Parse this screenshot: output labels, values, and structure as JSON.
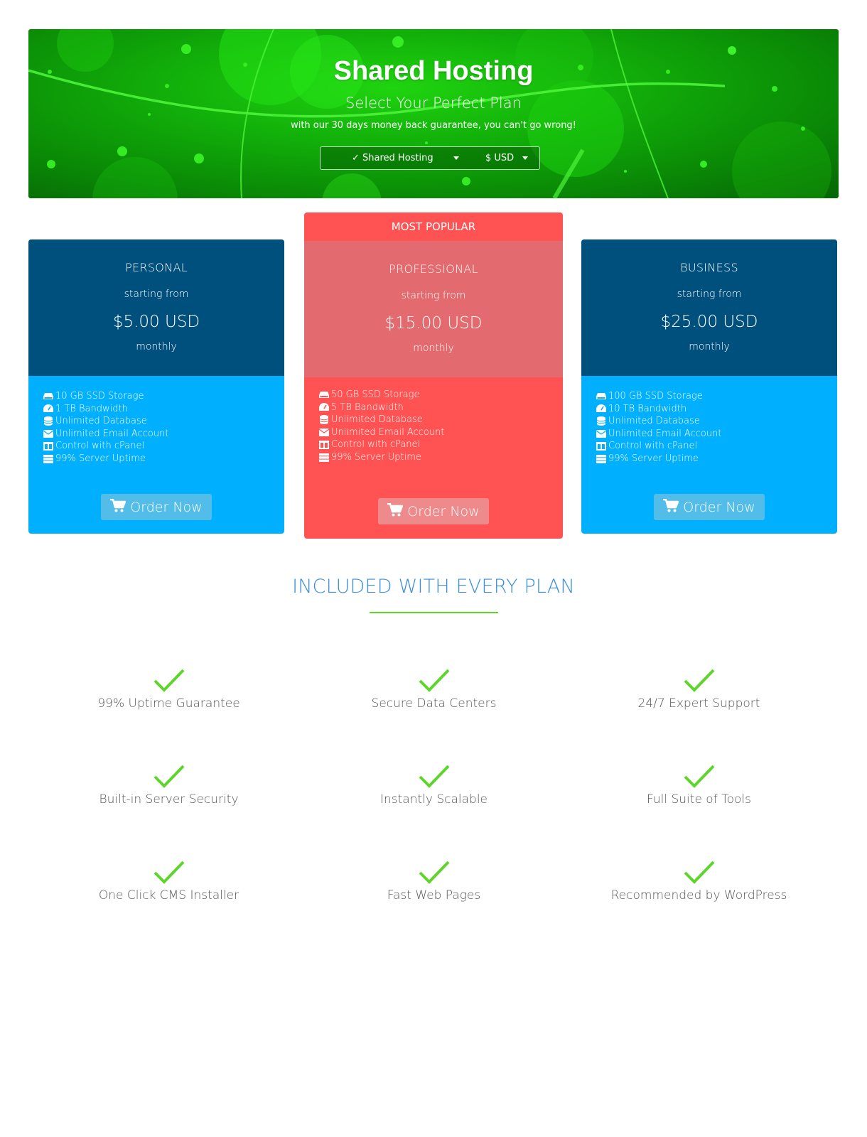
{
  "hero": {
    "title": "Shared Hosting",
    "subtitle": "Select Your Perfect Plan",
    "note": "with our 30 days money back guarantee, you can't go wrong!",
    "product_select": "✓ Shared Hosting",
    "currency_select": "$ USD"
  },
  "plans": [
    {
      "name": "PERSONAL",
      "starting_label": "starting from",
      "price": "$5.00 USD",
      "cycle": "monthly",
      "features": [
        "10 GB SSD Storage",
        "1 TB Bandwidth",
        "Unlimited Database",
        "Unlimited Email Account",
        "Control with cPanel",
        "99% Server Uptime"
      ],
      "button": "Order Now"
    },
    {
      "badge": "MOST POPULAR",
      "name": "PROFESSIONAL",
      "starting_label": "starting from",
      "price": "$15.00 USD",
      "cycle": "monthly",
      "features": [
        "50 GB SSD Storage",
        "5 TB Bandwidth",
        "Unlimited Database",
        "Unlimited Email Account",
        "Control with cPanel",
        "99% Server Uptime"
      ],
      "button": "Order Now"
    },
    {
      "name": "BUSINESS",
      "starting_label": "starting from",
      "price": "$25.00 USD",
      "cycle": "monthly",
      "features": [
        "100 GB SSD Storage",
        "10 TB Bandwidth",
        "Unlimited Database",
        "Unlimited Email Account",
        "Control with cPanel",
        "99% Server Uptime"
      ],
      "button": "Order Now"
    }
  ],
  "feature_icons": [
    "hdd-icon",
    "speedometer-icon",
    "database-icon",
    "envelope-icon",
    "columns-icon",
    "server-icon"
  ],
  "included": {
    "title": "INCLUDED WITH EVERY PLAN",
    "items": [
      "99% Uptime Guarantee",
      "Secure Data Centers",
      "24/7 Expert Support",
      "Built-in Server Security",
      "Instantly Scalable",
      "Full Suite of Tools",
      "One Click CMS Installer",
      "Fast Web Pages",
      "Recommended by WordPress"
    ]
  },
  "colors": {
    "hero_green": "#12b00a",
    "plan_dark": "#00507e",
    "plan_light": "#00b0ff",
    "popular_red": "#ff5252",
    "popular_head": "#e36a6e",
    "included_title": "#3b8fd9",
    "check_green": "#5dd52a"
  }
}
